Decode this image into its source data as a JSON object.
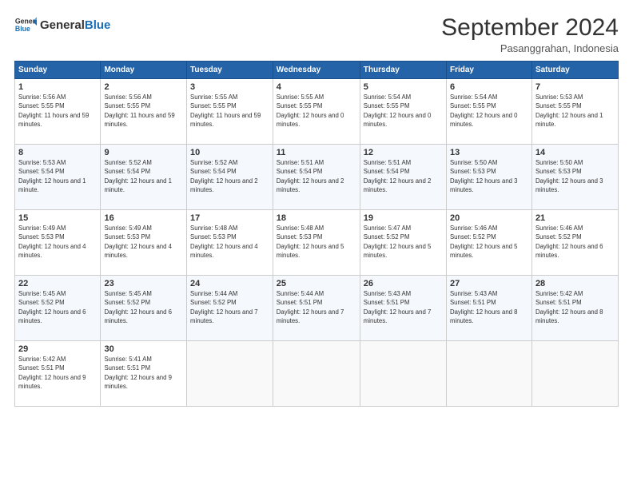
{
  "header": {
    "logo_line1": "General",
    "logo_line2": "Blue",
    "month": "September 2024",
    "location": "Pasanggrahan, Indonesia"
  },
  "days_of_week": [
    "Sunday",
    "Monday",
    "Tuesday",
    "Wednesday",
    "Thursday",
    "Friday",
    "Saturday"
  ],
  "weeks": [
    [
      {
        "day": "1",
        "sunrise": "5:56 AM",
        "sunset": "5:55 PM",
        "daylight": "11 hours and 59 minutes."
      },
      {
        "day": "2",
        "sunrise": "5:56 AM",
        "sunset": "5:55 PM",
        "daylight": "11 hours and 59 minutes."
      },
      {
        "day": "3",
        "sunrise": "5:55 AM",
        "sunset": "5:55 PM",
        "daylight": "11 hours and 59 minutes."
      },
      {
        "day": "4",
        "sunrise": "5:55 AM",
        "sunset": "5:55 PM",
        "daylight": "12 hours and 0 minutes."
      },
      {
        "day": "5",
        "sunrise": "5:54 AM",
        "sunset": "5:55 PM",
        "daylight": "12 hours and 0 minutes."
      },
      {
        "day": "6",
        "sunrise": "5:54 AM",
        "sunset": "5:55 PM",
        "daylight": "12 hours and 0 minutes."
      },
      {
        "day": "7",
        "sunrise": "5:53 AM",
        "sunset": "5:55 PM",
        "daylight": "12 hours and 1 minute."
      }
    ],
    [
      {
        "day": "8",
        "sunrise": "5:53 AM",
        "sunset": "5:54 PM",
        "daylight": "12 hours and 1 minute."
      },
      {
        "day": "9",
        "sunrise": "5:52 AM",
        "sunset": "5:54 PM",
        "daylight": "12 hours and 1 minute."
      },
      {
        "day": "10",
        "sunrise": "5:52 AM",
        "sunset": "5:54 PM",
        "daylight": "12 hours and 2 minutes."
      },
      {
        "day": "11",
        "sunrise": "5:51 AM",
        "sunset": "5:54 PM",
        "daylight": "12 hours and 2 minutes."
      },
      {
        "day": "12",
        "sunrise": "5:51 AM",
        "sunset": "5:54 PM",
        "daylight": "12 hours and 2 minutes."
      },
      {
        "day": "13",
        "sunrise": "5:50 AM",
        "sunset": "5:53 PM",
        "daylight": "12 hours and 3 minutes."
      },
      {
        "day": "14",
        "sunrise": "5:50 AM",
        "sunset": "5:53 PM",
        "daylight": "12 hours and 3 minutes."
      }
    ],
    [
      {
        "day": "15",
        "sunrise": "5:49 AM",
        "sunset": "5:53 PM",
        "daylight": "12 hours and 4 minutes."
      },
      {
        "day": "16",
        "sunrise": "5:49 AM",
        "sunset": "5:53 PM",
        "daylight": "12 hours and 4 minutes."
      },
      {
        "day": "17",
        "sunrise": "5:48 AM",
        "sunset": "5:53 PM",
        "daylight": "12 hours and 4 minutes."
      },
      {
        "day": "18",
        "sunrise": "5:48 AM",
        "sunset": "5:53 PM",
        "daylight": "12 hours and 5 minutes."
      },
      {
        "day": "19",
        "sunrise": "5:47 AM",
        "sunset": "5:52 PM",
        "daylight": "12 hours and 5 minutes."
      },
      {
        "day": "20",
        "sunrise": "5:46 AM",
        "sunset": "5:52 PM",
        "daylight": "12 hours and 5 minutes."
      },
      {
        "day": "21",
        "sunrise": "5:46 AM",
        "sunset": "5:52 PM",
        "daylight": "12 hours and 6 minutes."
      }
    ],
    [
      {
        "day": "22",
        "sunrise": "5:45 AM",
        "sunset": "5:52 PM",
        "daylight": "12 hours and 6 minutes."
      },
      {
        "day": "23",
        "sunrise": "5:45 AM",
        "sunset": "5:52 PM",
        "daylight": "12 hours and 6 minutes."
      },
      {
        "day": "24",
        "sunrise": "5:44 AM",
        "sunset": "5:52 PM",
        "daylight": "12 hours and 7 minutes."
      },
      {
        "day": "25",
        "sunrise": "5:44 AM",
        "sunset": "5:51 PM",
        "daylight": "12 hours and 7 minutes."
      },
      {
        "day": "26",
        "sunrise": "5:43 AM",
        "sunset": "5:51 PM",
        "daylight": "12 hours and 7 minutes."
      },
      {
        "day": "27",
        "sunrise": "5:43 AM",
        "sunset": "5:51 PM",
        "daylight": "12 hours and 8 minutes."
      },
      {
        "day": "28",
        "sunrise": "5:42 AM",
        "sunset": "5:51 PM",
        "daylight": "12 hours and 8 minutes."
      }
    ],
    [
      {
        "day": "29",
        "sunrise": "5:42 AM",
        "sunset": "5:51 PM",
        "daylight": "12 hours and 9 minutes."
      },
      {
        "day": "30",
        "sunrise": "5:41 AM",
        "sunset": "5:51 PM",
        "daylight": "12 hours and 9 minutes."
      },
      null,
      null,
      null,
      null,
      null
    ]
  ]
}
